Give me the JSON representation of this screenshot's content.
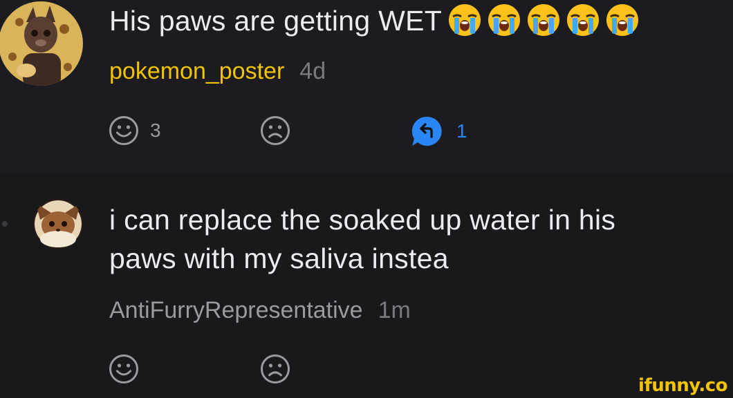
{
  "comments": [
    {
      "text": "His paws are getting WET",
      "emoji_count": 5,
      "emoji_name": "loudly-crying-face-icon",
      "author": "pokemon_poster",
      "author_color": "#f2c400",
      "time": "4d",
      "likes": "3",
      "replies": "1"
    },
    {
      "text_line1": "i can replace the soaked up water in his",
      "text_line2": "paws with my saliva instea",
      "author": "AntiFurryRepresentative",
      "author_color": "#9a9aa0",
      "time": "1m"
    }
  ],
  "colors": {
    "background": "#1c1c20",
    "text": "#ececf0",
    "reply_accent": "#2b86f5",
    "watermark": "#f5c400"
  },
  "watermark": "ifunny.co"
}
